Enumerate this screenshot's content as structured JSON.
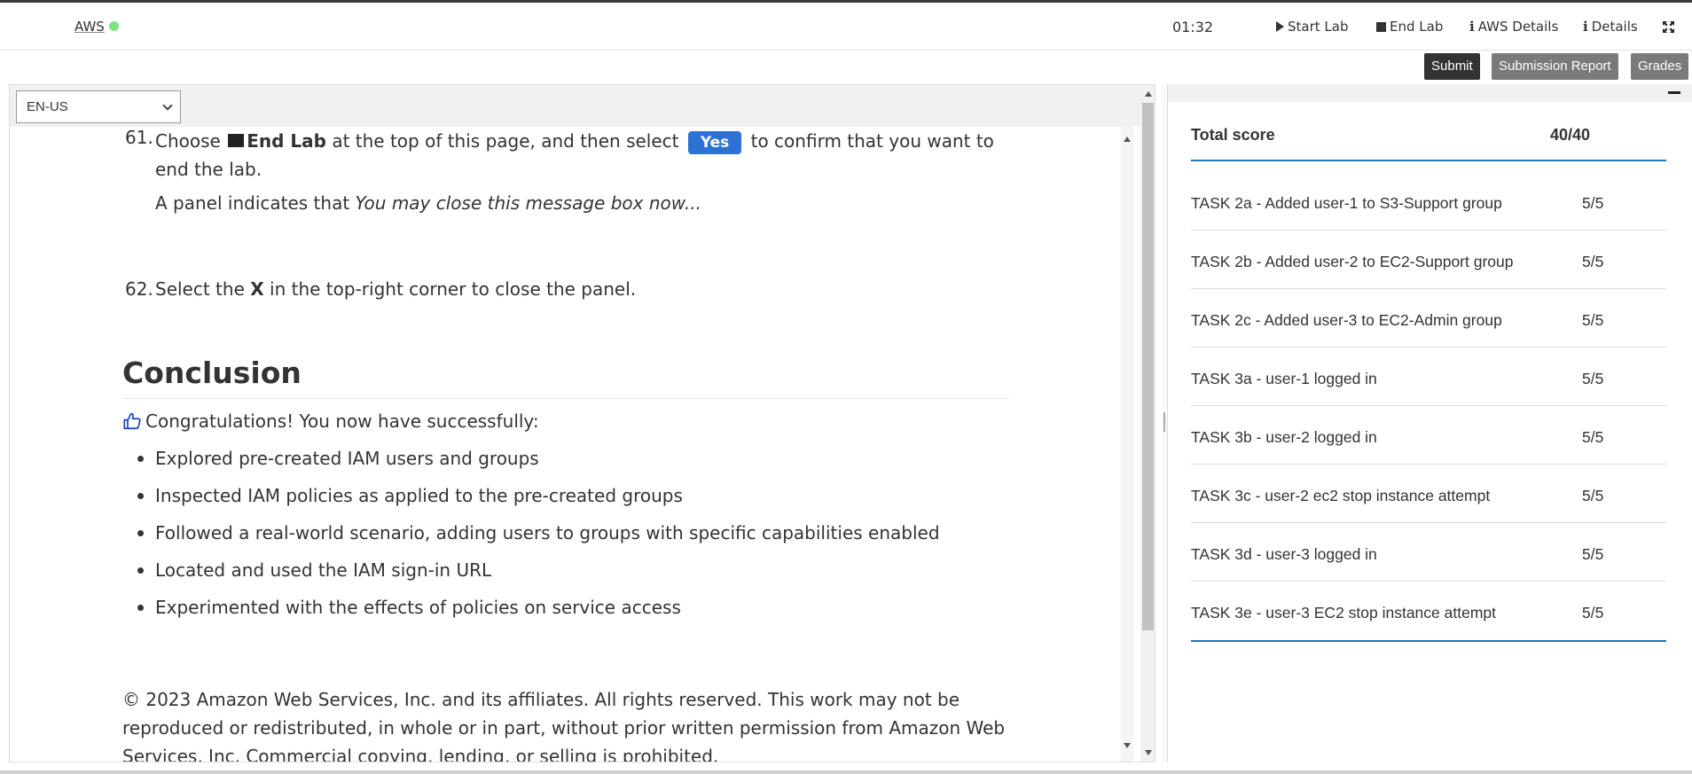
{
  "topbar": {
    "aws_label": "AWS",
    "status_color": "#7fe07f",
    "timer": "01:32",
    "start_lab": "Start Lab",
    "end_lab": "End Lab",
    "aws_details": "AWS Details",
    "details": "Details"
  },
  "actions": {
    "submit": "Submit",
    "submission_report": "Submission Report",
    "grades": "Grades"
  },
  "language": {
    "selected": "EN-US"
  },
  "doc": {
    "step61": {
      "number": "61.",
      "before": "Choose",
      "end_lab": "End Lab",
      "middle": "at the top of this page, and then select",
      "yes": "Yes",
      "after": "to confirm that you want to end the lab.",
      "note_prefix": "A panel indicates that",
      "note_italic": "You may close this message box now..."
    },
    "step62": {
      "number": "62.",
      "before": "Select the",
      "x": "X",
      "after": "in the top-right corner to close the panel."
    },
    "conclusion_title": "Conclusion",
    "congrats": "Congratulations! You now have successfully:",
    "bullets": [
      "Explored pre-created IAM users and groups",
      "Inspected IAM policies as applied to the pre-created groups",
      "Followed a real-world scenario, adding users to groups with specific capabilities enabled",
      "Located and used the IAM sign-in URL",
      "Experimented with the effects of policies on service access"
    ],
    "copyright": "© 2023 Amazon Web Services, Inc. and its affiliates. All rights reserved. This work may not be reproduced or redistributed, in whole or in part, without prior written permission from Amazon Web Services, Inc. Commercial copying, lending, or selling is prohibited."
  },
  "grades": {
    "total_label": "Total score",
    "total_value": "40/40",
    "accent_color": "#1f78b4",
    "rows": [
      {
        "task": "TASK 2a - Added user-1 to S3-Support group",
        "score": "5/5"
      },
      {
        "task": "TASK 2b - Added user-2 to EC2-Support group",
        "score": "5/5"
      },
      {
        "task": "TASK 2c - Added user-3 to EC2-Admin group",
        "score": "5/5"
      },
      {
        "task": "TASK 3a - user-1 logged in",
        "score": "5/5"
      },
      {
        "task": "TASK 3b - user-2 logged in",
        "score": "5/5"
      },
      {
        "task": "TASK 3c - user-2 ec2 stop instance attempt",
        "score": "5/5"
      },
      {
        "task": "TASK 3d - user-3 logged in",
        "score": "5/5"
      },
      {
        "task": "TASK 3e - user-3 EC2 stop instance attempt",
        "score": "5/5"
      }
    ]
  },
  "icons": {
    "play": "play-icon",
    "stop": "stop-square-icon",
    "info": "info-icon",
    "expand": "expand-icon",
    "thumbs_up": "thumbs-up-icon",
    "minimize": "minimize-icon"
  }
}
